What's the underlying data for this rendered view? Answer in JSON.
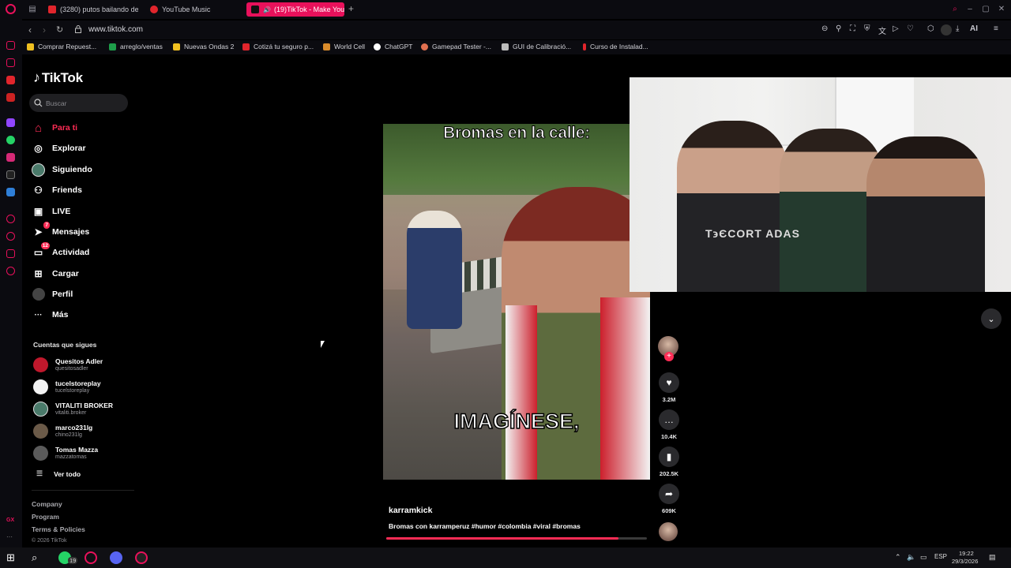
{
  "browser": {
    "tabs": [
      {
        "label": "(3280) putos bailando de",
        "color": "#e1252c"
      },
      {
        "label": "YouTube Music",
        "color": "#e1252c"
      },
      {
        "label": "(19)TikTok - Make You",
        "color": "#111111"
      }
    ],
    "new_tab_symbol": "+",
    "url": "www.tiktok.com",
    "bookmarks": [
      {
        "label": "Comprar Repuest...",
        "color": "#f0c020"
      },
      {
        "label": "arreglo/ventas",
        "color": "#1e9e4a"
      },
      {
        "label": "Nuevas Ondas 2",
        "color": "#f0c020"
      },
      {
        "label": "Cotizá tu seguro p...",
        "color": "#e1252c"
      },
      {
        "label": "World Cell",
        "color": "#d98b2b"
      },
      {
        "label": "ChatGPT",
        "color": "#ffffff"
      },
      {
        "label": "Gamepad Tester -...",
        "color": "#e07050"
      },
      {
        "label": "GUI de Calibració...",
        "color": "#bbbbbb"
      },
      {
        "label": "Curso de Instalad...",
        "color": "#e1252c"
      }
    ],
    "extension_badge": "AI"
  },
  "tiktok": {
    "logo": "TikTok",
    "search_placeholder": "Buscar",
    "nav": [
      {
        "label": "Para ti",
        "icon": "home-icon",
        "glyph": "⌂",
        "active": true,
        "badge": ""
      },
      {
        "label": "Explorar",
        "icon": "compass-icon",
        "glyph": "◎",
        "active": false,
        "badge": ""
      },
      {
        "label": "Siguiendo",
        "icon": "following-avatar-icon",
        "glyph": "●",
        "active": false,
        "badge": ""
      },
      {
        "label": "Friends",
        "icon": "friends-icon",
        "glyph": "⚇",
        "active": false,
        "badge": ""
      },
      {
        "label": "LIVE",
        "icon": "live-tv-icon",
        "glyph": "▣",
        "active": false,
        "badge": ""
      },
      {
        "label": "Mensajes",
        "icon": "messages-send-icon",
        "glyph": "➤",
        "active": false,
        "badge": "7"
      },
      {
        "label": "Actividad",
        "icon": "activity-inbox-icon",
        "glyph": "▭",
        "active": false,
        "badge": "12"
      },
      {
        "label": "Cargar",
        "icon": "upload-plus-icon",
        "glyph": "⊞",
        "active": false,
        "badge": ""
      },
      {
        "label": "Perfil",
        "icon": "profile-avatar-icon",
        "glyph": "●",
        "active": false,
        "badge": ""
      },
      {
        "label": "Más",
        "icon": "more-dots-icon",
        "glyph": "···",
        "active": false,
        "badge": ""
      }
    ],
    "following_title": "Cuentas que sigues",
    "following": [
      {
        "name": "Quesitos Adler",
        "handle": "quesitosadler",
        "color": "#c0182c"
      },
      {
        "name": "tucelstoreplay",
        "handle": "tucelstoreplay",
        "color": "#f2f2f2"
      },
      {
        "name": "VITALITI BROKER",
        "handle": "vitaliti.broker",
        "color": "#4a7a6a"
      },
      {
        "name": "marco231lg",
        "handle": "chino231lg",
        "color": "#6b5a48"
      },
      {
        "name": "Tomas Mazza",
        "handle": "mazzatomas",
        "color": "#5b5b5b"
      }
    ],
    "see_all": "Ver todo",
    "footer_links": [
      "Company",
      "Program",
      "Terms & Policies"
    ],
    "copyright": "© 2026 TikTok",
    "video": {
      "caption_top": "Bromas en la calle:",
      "caption_mid": "IMAGÍNESE,",
      "author": "karramkick",
      "description": "Bromas con karramperuz #humor #colombia #viral #bromas",
      "progress": 0.89
    },
    "actions": {
      "likes": "3.2M",
      "comments": "10.4K",
      "saves": "202.5K",
      "shares": "609K",
      "follow_symbol": "+"
    },
    "webcam_shirt_text": "T϶ЄCORT ADAS"
  },
  "taskbar": {
    "whatsapp_count": "19",
    "language": "ESP",
    "time": "19:22",
    "date": "29/3/2026"
  }
}
